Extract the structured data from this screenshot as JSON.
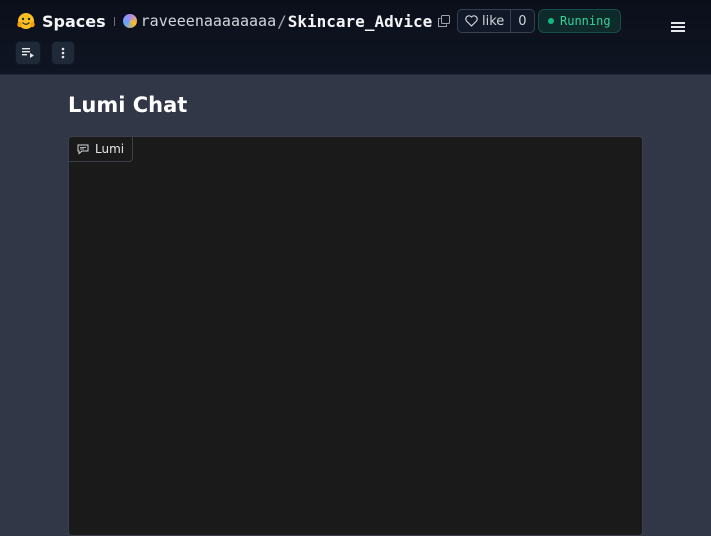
{
  "header": {
    "brand": "Spaces",
    "owner": "raveeenaaaaaaaa",
    "separator": "/",
    "repo": "Skincare_Advice",
    "like_label": "like",
    "like_count": "0",
    "status": "Running"
  },
  "page": {
    "title": "Lumi Chat"
  },
  "chatbot": {
    "label": "Lumi"
  }
}
